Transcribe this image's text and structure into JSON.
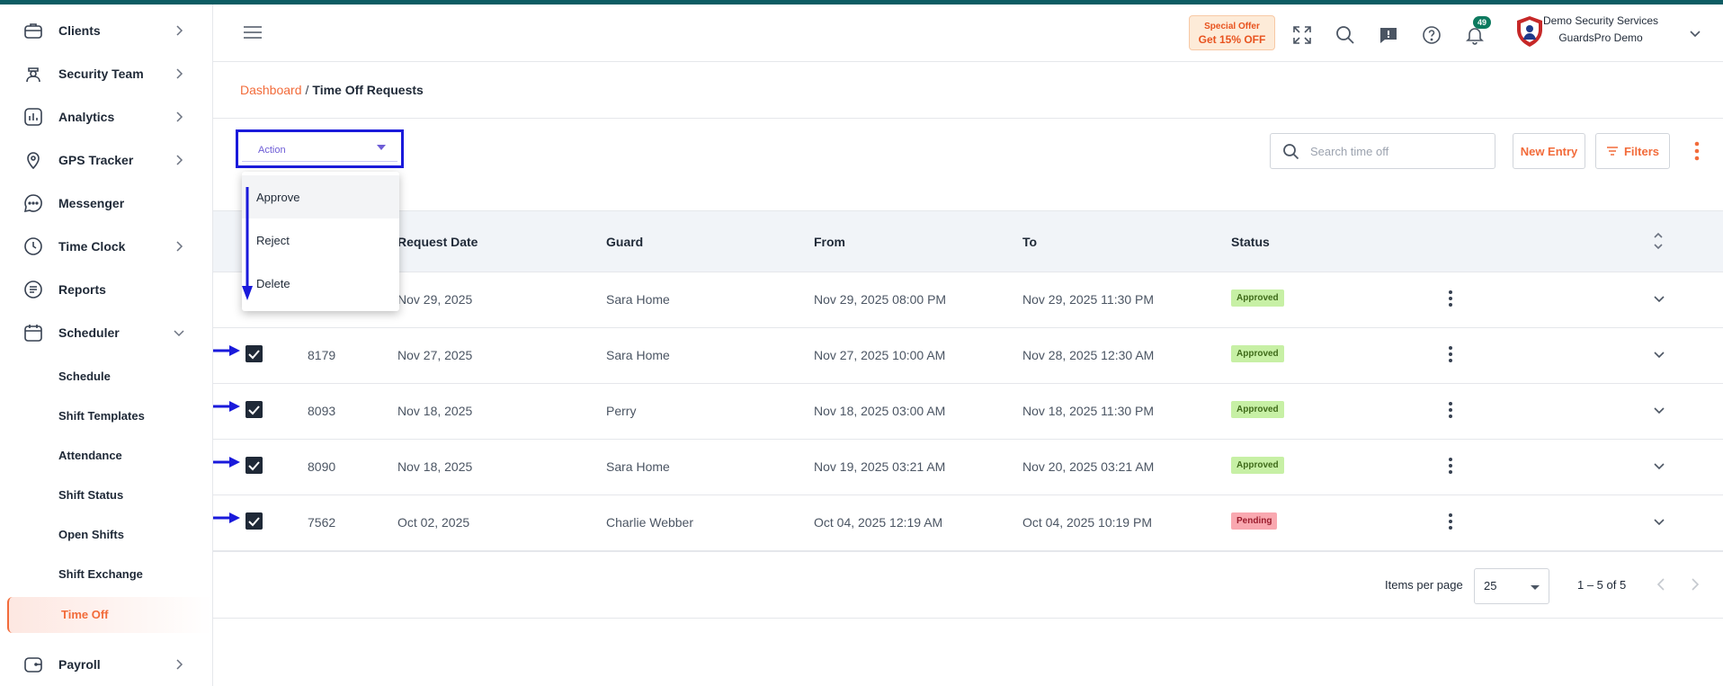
{
  "sidebar": {
    "items": [
      {
        "label": "Clients",
        "icon": "briefcase-icon"
      },
      {
        "label": "Security Team",
        "icon": "security-guard-icon"
      },
      {
        "label": "Analytics",
        "icon": "bar-chart-icon"
      },
      {
        "label": "GPS Tracker",
        "icon": "location-pin-icon"
      },
      {
        "label": "Messenger",
        "icon": "chat-bubble-icon"
      },
      {
        "label": "Time Clock",
        "icon": "clock-icon"
      },
      {
        "label": "Reports",
        "icon": "report-document-icon"
      },
      {
        "label": "Scheduler",
        "icon": "calendar-icon"
      },
      {
        "label": "Payroll",
        "icon": "wallet-icon"
      }
    ],
    "scheduler_subitems": [
      "Schedule",
      "Shift Templates",
      "Attendance",
      "Shift Status",
      "Open Shifts",
      "Shift Exchange",
      "Time Off"
    ],
    "active_item": "Time Off"
  },
  "header": {
    "offer_line1": "Special Offer",
    "offer_line2": "Get 15% OFF",
    "notification_count": "49",
    "company_name": "Demo Security Services",
    "company_subtitle": "GuardsPro Demo"
  },
  "breadcrumb": {
    "root": "Dashboard",
    "separator": "/",
    "current": "Time Off Requests"
  },
  "action_select": {
    "placeholder": "Action",
    "options": [
      "Approve",
      "Reject",
      "Delete"
    ]
  },
  "search": {
    "placeholder": "Search time off"
  },
  "buttons": {
    "new_entry": "New Entry",
    "filters": "Filters"
  },
  "table": {
    "columns": [
      "Request Date",
      "Guard",
      "From",
      "To",
      "Status"
    ],
    "rows": [
      {
        "id": "",
        "request_date": "Nov 29, 2025",
        "guard": "Sara Home",
        "from": "Nov 29, 2025 08:00 PM",
        "to": "Nov 29, 2025 11:30 PM",
        "status": "Approved",
        "checked": false
      },
      {
        "id": "8179",
        "request_date": "Nov 27, 2025",
        "guard": "Sara Home",
        "from": "Nov 27, 2025 10:00 AM",
        "to": "Nov 28, 2025 12:30 AM",
        "status": "Approved",
        "checked": true
      },
      {
        "id": "8093",
        "request_date": "Nov 18, 2025",
        "guard": "Perry",
        "from": "Nov 18, 2025 03:00 AM",
        "to": "Nov 18, 2025 11:30 PM",
        "status": "Approved",
        "checked": true
      },
      {
        "id": "8090",
        "request_date": "Nov 18, 2025",
        "guard": "Sara Home",
        "from": "Nov 19, 2025 03:21 AM",
        "to": "Nov 20, 2025 03:21 AM",
        "status": "Approved",
        "checked": true
      },
      {
        "id": "7562",
        "request_date": "Oct 02, 2025",
        "guard": "Charlie Webber",
        "from": "Oct 04, 2025 12:19 AM",
        "to": "Oct 04, 2025 10:19 PM",
        "status": "Pending",
        "checked": true
      }
    ]
  },
  "pagination": {
    "items_per_page_label": "Items per page",
    "items_per_page": "25",
    "range": "1 – 5 of 5"
  },
  "colors": {
    "accent": "#f26b3a",
    "highlight_box": "#1a1adb",
    "approved_bg": "#c7f0a5",
    "pending_bg": "#f9a8b0"
  }
}
